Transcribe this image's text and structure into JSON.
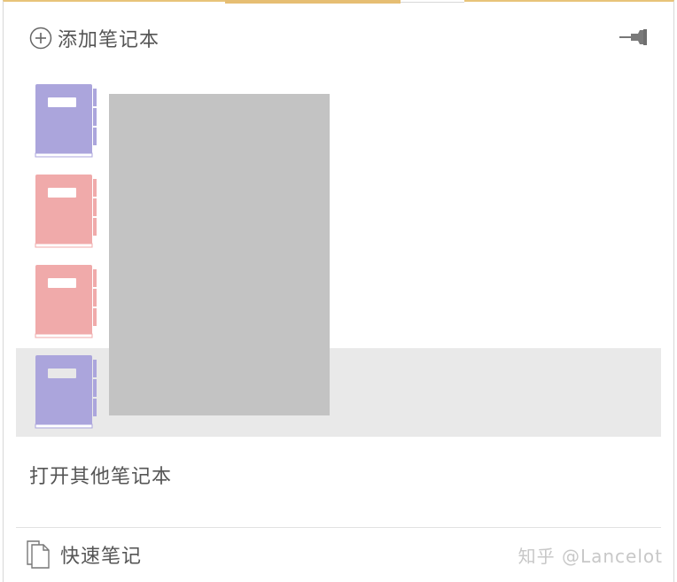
{
  "header": {
    "add_notebook_label": "添加笔记本"
  },
  "notebooks": [
    {
      "color": "#aba5dc",
      "label_color": "#ffffff",
      "name": ""
    },
    {
      "color": "#f0aaaa",
      "label_color": "#ffffff",
      "name": ""
    },
    {
      "color": "#f0aaaa",
      "label_color": "#ffffff",
      "name": ""
    },
    {
      "color": "#aba5dc",
      "label_color": "#e8e8e8",
      "name": ""
    }
  ],
  "open_other_label": "打开其他笔记本",
  "footer": {
    "quick_notes_label": "快速笔记"
  },
  "watermark": "知乎 @Lancelot",
  "colors": {
    "accent": "#e6be73",
    "selected_row": "#e9e9e9",
    "purple_notebook": "#aba5dc",
    "pink_notebook": "#f0aaaa",
    "redaction": "#c3c3c3"
  }
}
